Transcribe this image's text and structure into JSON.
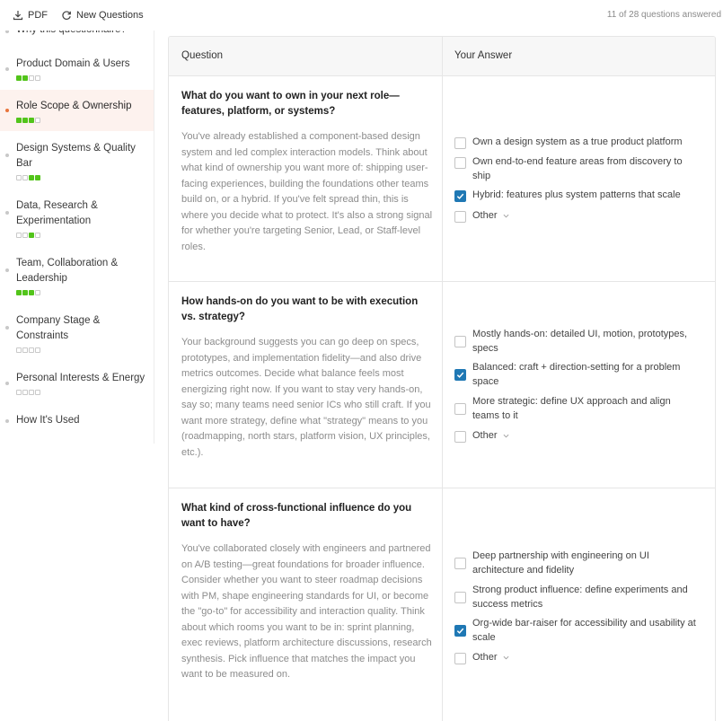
{
  "toolbar": {
    "pdf_label": "PDF",
    "new_questions_label": "New Questions",
    "progress_text": "11 of 28 questions answered"
  },
  "sidebar": {
    "items": [
      {
        "label": "Why this questionnaire?",
        "progress": null
      },
      {
        "label": "Product Domain & Users",
        "progress": [
          1,
          1,
          0,
          0
        ]
      },
      {
        "label": "Role Scope & Ownership",
        "progress": [
          1,
          1,
          1,
          0
        ],
        "active": true
      },
      {
        "label": "Design Systems & Quality Bar",
        "progress": [
          0,
          0,
          1,
          1
        ]
      },
      {
        "label": "Data, Research & Experimentation",
        "progress": [
          0,
          0,
          1,
          0
        ]
      },
      {
        "label": "Team, Collaboration & Leadership",
        "progress": [
          1,
          1,
          1,
          0
        ]
      },
      {
        "label": "Company Stage & Constraints",
        "progress": [
          0,
          0,
          0,
          0
        ]
      },
      {
        "label": "Personal Interests & Energy",
        "progress": [
          0,
          0,
          0,
          0
        ]
      },
      {
        "label": "How It's Used",
        "progress": null
      }
    ]
  },
  "table": {
    "question_header": "Question",
    "answer_header": "Your Answer"
  },
  "questions": [
    {
      "title": "What do you want to own in your next role—features, platform, or systems?",
      "description": "You've already established a component-based design system and led complex interaction models. Think about what kind of ownership you want more of: shipping user-facing experiences, building the foundations other teams build on, or a hybrid. If you've felt spread thin, this is where you decide what to protect. It's also a strong signal for whether you're targeting Senior, Lead, or Staff-level roles.",
      "options": [
        {
          "label": "Own a design system as a true product platform",
          "checked": false
        },
        {
          "label": "Own end-to-end feature areas from discovery to ship",
          "checked": false
        },
        {
          "label": "Hybrid: features plus system patterns that scale",
          "checked": true
        },
        {
          "label": "Other",
          "checked": false
        }
      ]
    },
    {
      "title": "How hands-on do you want to be with execution vs. strategy?",
      "description": "Your background suggests you can go deep on specs, prototypes, and implementation fidelity—and also drive metrics outcomes. Decide what balance feels most energizing right now. If you want to stay very hands-on, say so; many teams need senior ICs who still craft. If you want more strategy, define what \"strategy\" means to you (roadmapping, north stars, platform vision, UX principles, etc.).",
      "options": [
        {
          "label": "Mostly hands-on: detailed UI, motion, prototypes, specs",
          "checked": false
        },
        {
          "label": "Balanced: craft + direction-setting for a problem space",
          "checked": true
        },
        {
          "label": "More strategic: define UX approach and align teams to it",
          "checked": false
        },
        {
          "label": "Other",
          "checked": false
        }
      ]
    },
    {
      "title": "What kind of cross-functional influence do you want to have?",
      "description": "You've collaborated closely with engineers and partnered on A/B testing—great foundations for broader influence. Consider whether you want to steer roadmap decisions with PM, shape engineering standards for UI, or become the \"go-to\" for accessibility and interaction quality. Think about which rooms you want to be in: sprint planning, exec reviews, platform architecture discussions, research synthesis. Pick influence that matches the impact you want to be measured on.",
      "options": [
        {
          "label": "Deep partnership with engineering on UI architecture and fidelity",
          "checked": false
        },
        {
          "label": "Strong product influence: define experiments and success metrics",
          "checked": false
        },
        {
          "label": "Org-wide bar-raiser for accessibility and usability at scale",
          "checked": true
        },
        {
          "label": "Other",
          "checked": false
        }
      ]
    }
  ],
  "colors": {
    "accent_orange": "#e8743b",
    "progress_green": "#52c41a",
    "checkbox_blue": "#1f78b4"
  }
}
